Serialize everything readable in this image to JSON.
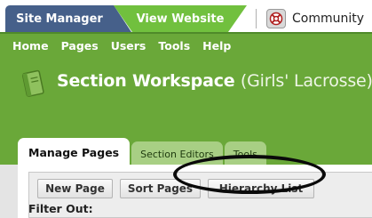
{
  "top_tabs": {
    "site_manager": "Site Manager",
    "view_website": "View Website",
    "community": "Community"
  },
  "nav": [
    "Home",
    "Pages",
    "Users",
    "Tools",
    "Help"
  ],
  "workspace": {
    "title": "Section Workspace",
    "subtitle": "(Girls' Lacrosse)"
  },
  "tabs": {
    "manage_pages": "Manage Pages",
    "section_editors": "Section Editors",
    "tools": "Tools"
  },
  "buttons": {
    "new_page": "New Page",
    "sort_pages": "Sort Pages",
    "hierarchy_list": "Hierarchy List"
  },
  "filter_label": "Filter Out:",
  "colors": {
    "site_manager_tab": "#46608a",
    "view_website_tab": "#71c03e",
    "header_green": "#6aa839",
    "annotation_ellipse": "#0a0a0a"
  },
  "icons": {
    "community": "life-ring-icon",
    "workspace": "notebook-icon"
  }
}
